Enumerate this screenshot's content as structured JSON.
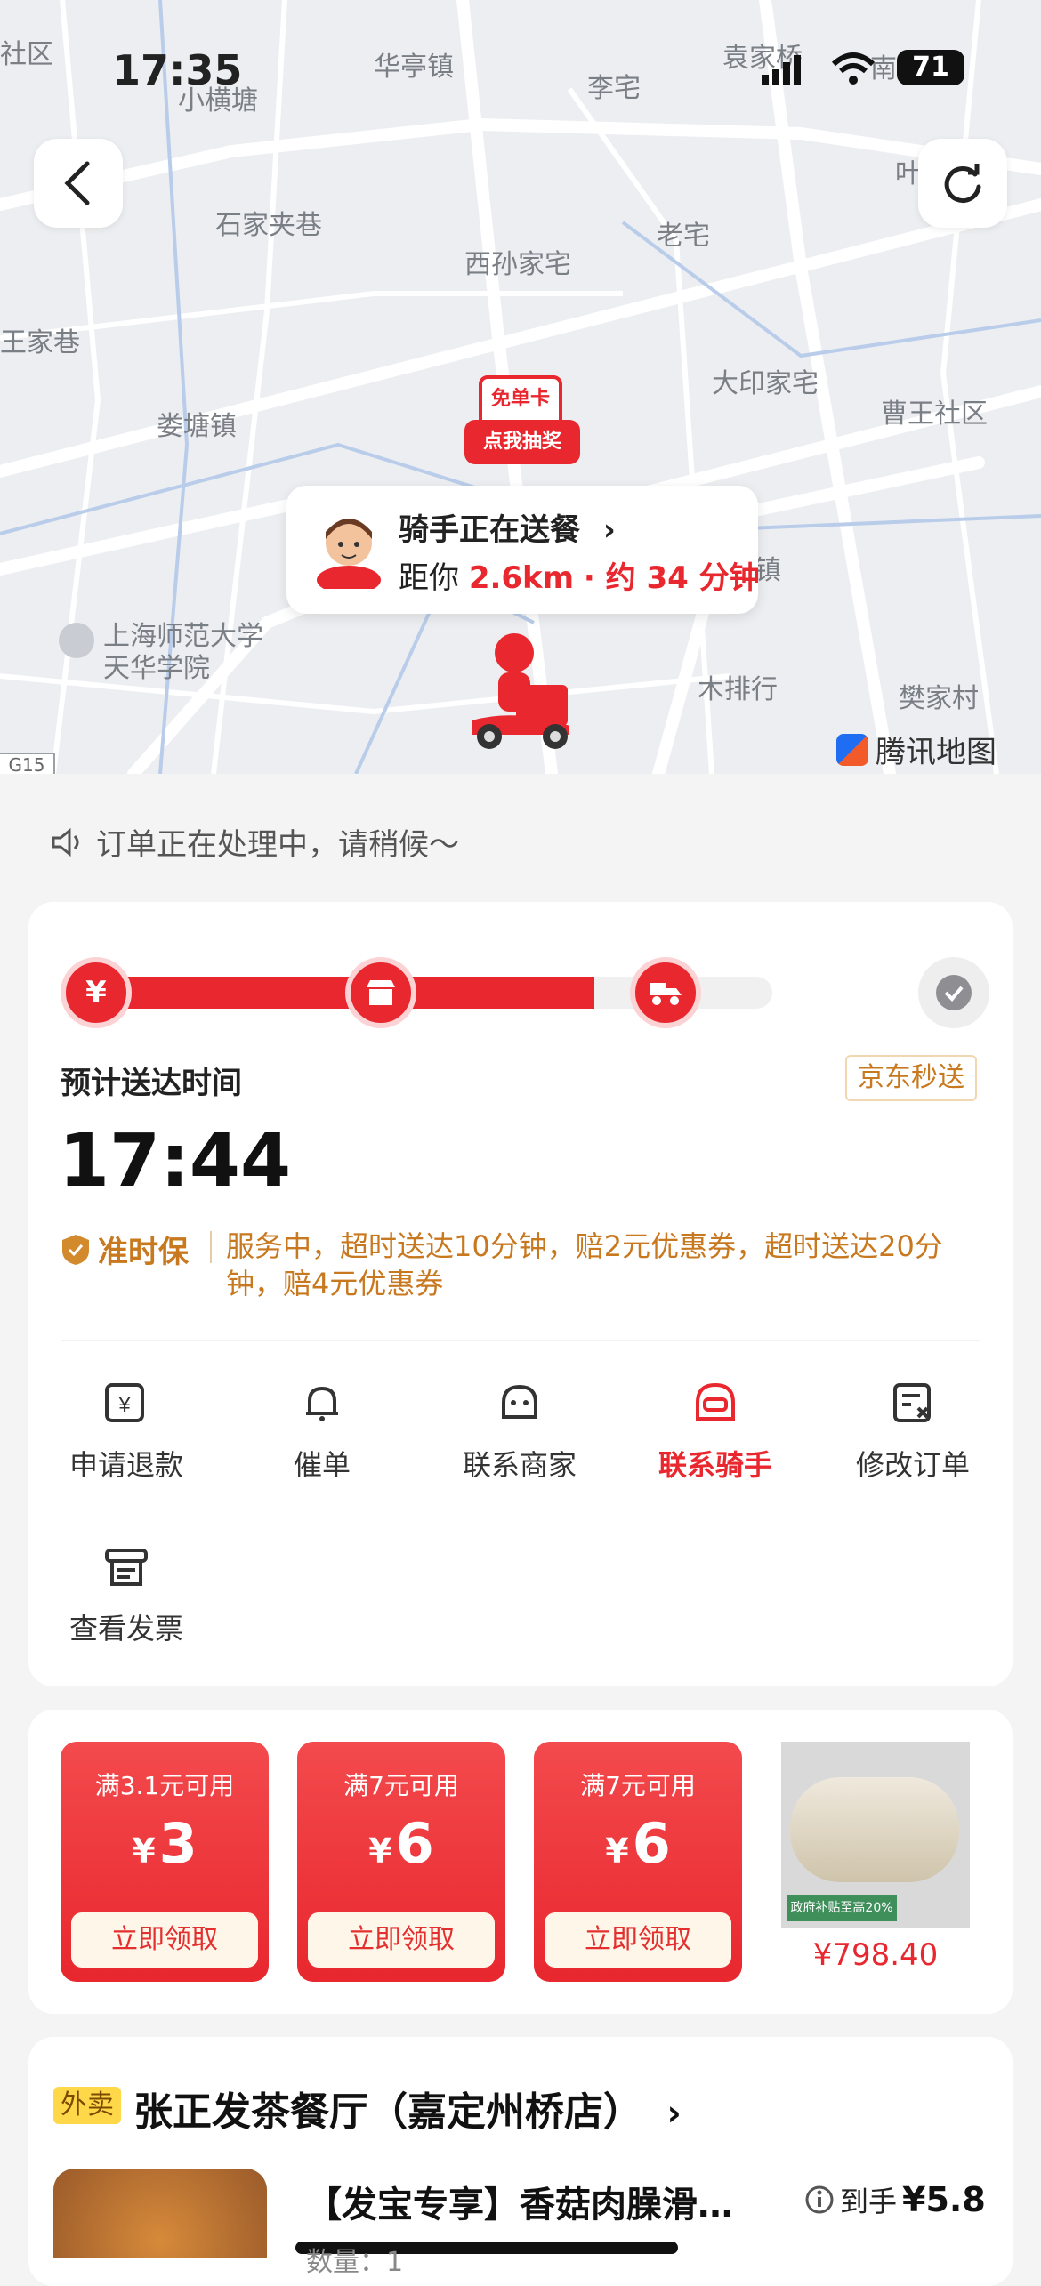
{
  "status_bar": {
    "time": "17:35",
    "battery": "71"
  },
  "map": {
    "places": [
      "华亭镇",
      "李宅",
      "袁家桥",
      "南",
      "小横塘",
      "叶",
      "石家夹巷",
      "老宅",
      "西孙家宅",
      "王家巷",
      "大印家宅",
      "曹王社区",
      "娄塘镇",
      "镇",
      "上海师范大学",
      "天华学院",
      "木排行",
      "樊家村",
      "社区",
      "G15"
    ],
    "promo_tag": "免单卡",
    "promo_button": "点我抽奖",
    "rider_status": "骑手正在送餐",
    "distance_prefix": "距你",
    "distance": "2.6km",
    "eta_text": "· 约 34 分钟",
    "map_brand": "腾讯地图"
  },
  "notice": "订单正在处理中，请稍候～",
  "delivery": {
    "eta_label": "预计送达时间",
    "service_tag": "京东秒送",
    "eta_time": "17:44",
    "ontime_label": "准时保",
    "ontime_text": "服务中，超时送达10分钟，赔2元优惠券，超时送达20分钟，赔4元优惠券",
    "progress": 0.75,
    "actions": [
      {
        "label": "申请退款",
        "icon": "refund-icon"
      },
      {
        "label": "催单",
        "icon": "bell-icon"
      },
      {
        "label": "联系商家",
        "icon": "store-chat-icon"
      },
      {
        "label": "联系骑手",
        "icon": "rider-helmet-icon"
      },
      {
        "label": "修改订单",
        "icon": "edit-order-icon"
      },
      {
        "label": "查看发票",
        "icon": "invoice-icon"
      }
    ]
  },
  "coupons": [
    {
      "condition": "满3.1元可用",
      "currency": "¥",
      "amount": "3",
      "button": "立即领取"
    },
    {
      "condition": "满7元可用",
      "currency": "¥",
      "amount": "6",
      "button": "立即领取"
    },
    {
      "condition": "满7元可用",
      "currency": "¥",
      "amount": "6",
      "button": "立即领取"
    }
  ],
  "product_ad": {
    "badge": "政府补贴至高20%",
    "price": "¥798.40"
  },
  "store": {
    "tag": "外卖",
    "name": "张正发茶餐厅（嘉定州桥店）",
    "item_name": "【发宝专享】香菇肉臊滑…",
    "item_qty": "数量：1",
    "price_prefix": "到手",
    "price": "¥5.8"
  },
  "colors": {
    "accent": "#e8272e",
    "gold": "#c8781e",
    "text": "#222222"
  }
}
